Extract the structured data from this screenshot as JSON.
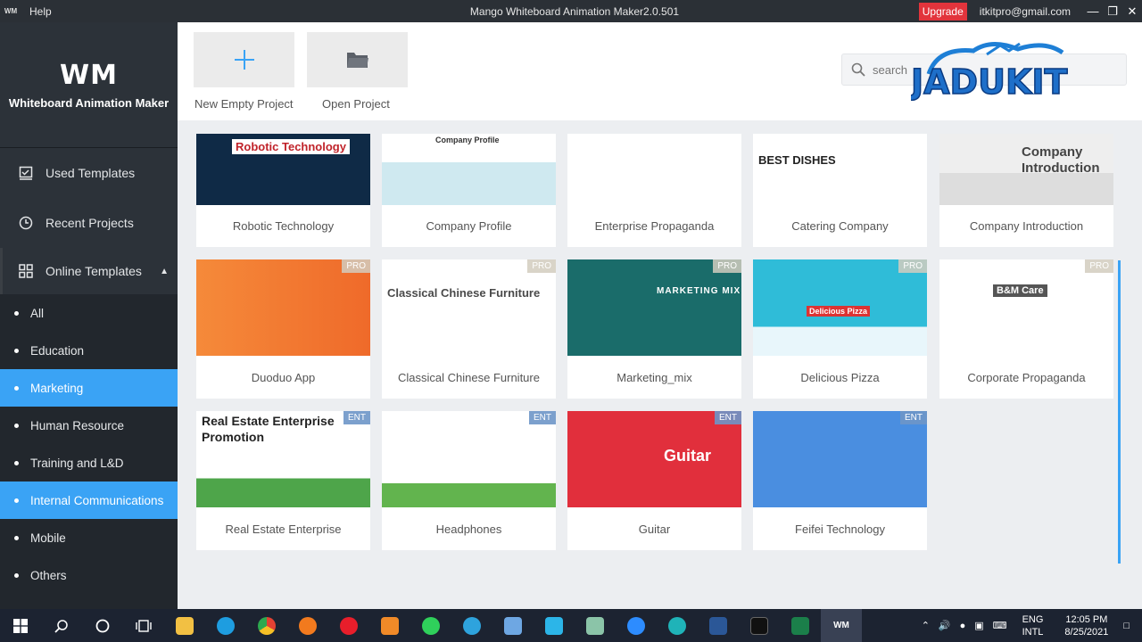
{
  "titlebar": {
    "logo": "WM",
    "menu_help": "Help",
    "title": "Mango Whiteboard Animation Maker2.0.501",
    "upgrade": "Upgrade",
    "email": "itkitpro@gmail.com"
  },
  "sidebar": {
    "logo": "WM",
    "brand": "Whiteboard Animation Maker",
    "used_templates": "Used Templates",
    "recent_projects": "Recent Projects",
    "online_templates": "Online Templates",
    "categories": [
      "All",
      "Education",
      "Marketing",
      "Human Resource",
      "Training and L&D",
      "Internal Communications",
      "Mobile",
      "Others"
    ],
    "selected_category": "Marketing"
  },
  "toolbar": {
    "new_project": "New Empty Project",
    "open_project": "Open Project",
    "search_placeholder": "search",
    "watermark": "JADUKIT"
  },
  "templates": [
    {
      "name": "Robotic Technology",
      "thumb_text": "Robotic Technology",
      "badge": ""
    },
    {
      "name": "Company Profile",
      "thumb_text": "Company Profile",
      "badge": ""
    },
    {
      "name": "Enterprise Propaganda",
      "thumb_text": "",
      "badge": ""
    },
    {
      "name": "Catering Company",
      "thumb_text": "BEST DISHES",
      "badge": ""
    },
    {
      "name": "Company Introduction",
      "thumb_text": "Company Introduction",
      "badge": ""
    },
    {
      "name": "Duoduo App",
      "thumb_text": "",
      "badge": "PRO"
    },
    {
      "name": "Classical Chinese Furniture",
      "thumb_text": "Classical Chinese Furniture",
      "badge": "PRO"
    },
    {
      "name": "Marketing_mix",
      "thumb_text": "MARKETING MIX",
      "badge": "PRO"
    },
    {
      "name": "Delicious Pizza",
      "thumb_text": "Delicious Pizza",
      "badge": "PRO"
    },
    {
      "name": "Corporate Propaganda",
      "thumb_text": "B&M Care",
      "badge": "PRO"
    },
    {
      "name": "Real Estate Enterprise",
      "thumb_text": "Real Estate Enterprise Promotion",
      "badge": "ENT"
    },
    {
      "name": "Headphones",
      "thumb_text": "",
      "badge": "ENT"
    },
    {
      "name": "Guitar",
      "thumb_text": "Guitar",
      "badge": "ENT"
    },
    {
      "name": "Feifei Technology",
      "thumb_text": "",
      "badge": "ENT"
    }
  ],
  "taskbar": {
    "lang1": "ENG",
    "lang2": "INTL",
    "time": "12:05 PM",
    "date": "8/25/2021"
  },
  "colors": {
    "accent": "#3aa3f5",
    "sidebar_bg": "#22272d",
    "upgrade": "#e2343c"
  }
}
